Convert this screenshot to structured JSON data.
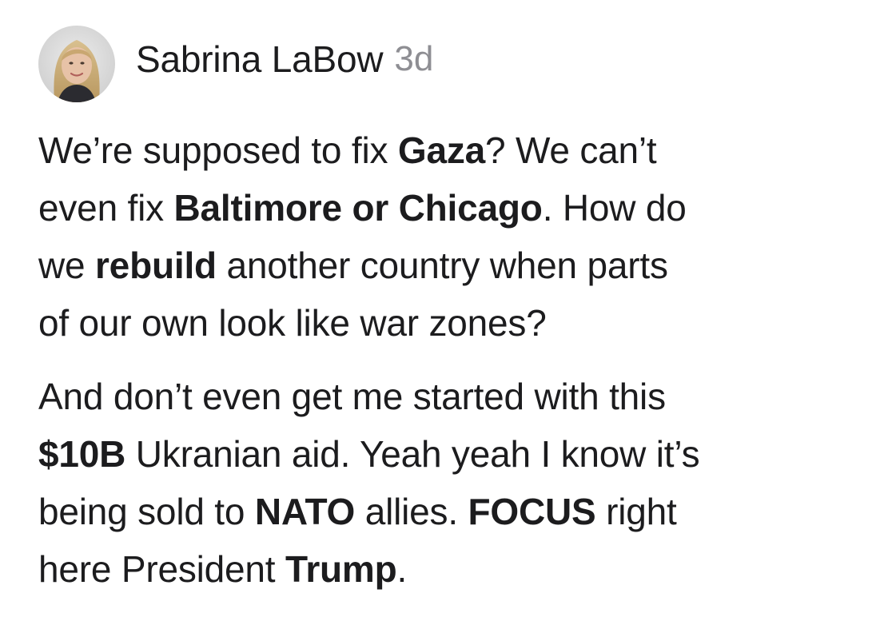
{
  "post": {
    "author": "Sabrina LaBow",
    "timestamp": "3d",
    "avatar_icon": "profile-photo",
    "paragraphs": [
      {
        "lines": [
          [
            {
              "text": "We’re supposed to fix ",
              "bold": false
            },
            {
              "text": "Gaza",
              "bold": true
            },
            {
              "text": "? We can’t",
              "bold": false
            }
          ],
          [
            {
              "text": "even fix ",
              "bold": false
            },
            {
              "text": "Baltimore or Chicago",
              "bold": true
            },
            {
              "text": ". How do",
              "bold": false
            }
          ],
          [
            {
              "text": "we ",
              "bold": false
            },
            {
              "text": "rebuild",
              "bold": true
            },
            {
              "text": " another country when parts",
              "bold": false
            }
          ],
          [
            {
              "text": "of our own look like war zones?",
              "bold": false
            }
          ]
        ]
      },
      {
        "lines": [
          [
            {
              "text": "And don’t even get me started with this",
              "bold": false
            }
          ],
          [
            {
              "text": "$10B",
              "bold": true
            },
            {
              "text": " Ukranian aid. Yeah yeah I know it’s",
              "bold": false
            }
          ],
          [
            {
              "text": "being sold to ",
              "bold": false
            },
            {
              "text": "NATO",
              "bold": true
            },
            {
              "text": " allies. ",
              "bold": false
            },
            {
              "text": "FOCUS",
              "bold": true
            },
            {
              "text": " right",
              "bold": false
            }
          ],
          [
            {
              "text": "here President ",
              "bold": false
            },
            {
              "text": "Trump",
              "bold": true
            },
            {
              "text": ".",
              "bold": false
            }
          ]
        ]
      }
    ]
  },
  "colors": {
    "text": "#1c1c1e",
    "secondary": "#8e8e93",
    "background": "#ffffff"
  }
}
